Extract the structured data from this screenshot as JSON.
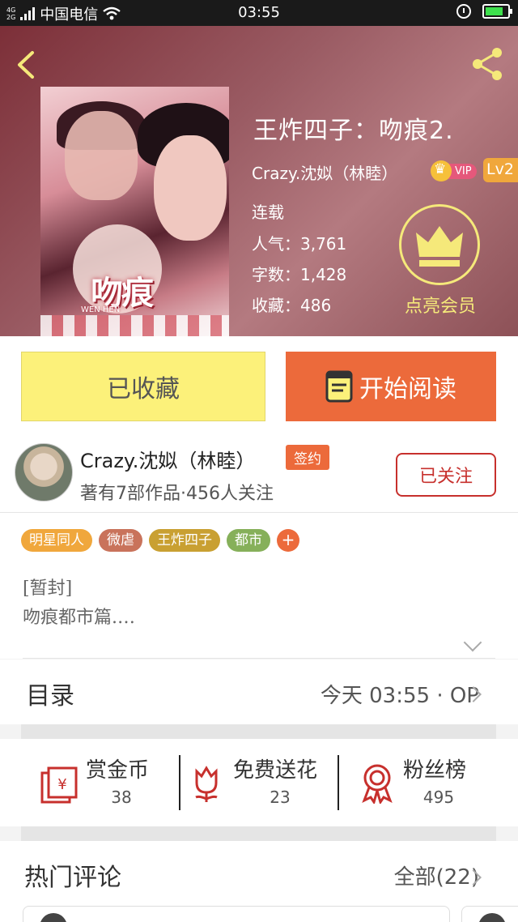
{
  "status_bar": {
    "carrier": "中国电信",
    "net_top": "4G",
    "net_bottom": "2G",
    "time": "03:55"
  },
  "book": {
    "title": "王炸四子：吻痕2.",
    "author": "Crazy.沈姒（林睦）",
    "vip_label": "VIP",
    "level": "Lv2",
    "status": "连载",
    "popularity_label": "人气：",
    "popularity": "3,761",
    "words_label": "字数：",
    "words": "1,428",
    "favorites_label": "收藏：",
    "favorites": "486",
    "member_label": "点亮会员",
    "cover_title": "吻痕",
    "cover_subtitle": "WEN HEN"
  },
  "actions": {
    "collected_label": "已收藏",
    "read_label": "开始阅读"
  },
  "author": {
    "name": "Crazy.沈姒（林睦）",
    "signed_label": "签约",
    "meta": "著有7部作品·456人关注",
    "follow_label": "已关注"
  },
  "tags": [
    {
      "label": "明星同人",
      "color": "#f0a73c"
    },
    {
      "label": "微虐",
      "color": "#c9735b"
    },
    {
      "label": "王炸四子",
      "color": "#c9a032"
    },
    {
      "label": "都市",
      "color": "#86b05a"
    }
  ],
  "tag_more": "+",
  "description": {
    "line1": "[暂封]",
    "line2": "吻痕都市篇.…"
  },
  "catalog": {
    "label": "目录",
    "latest": "今天 03:55 · OP"
  },
  "rewards": [
    {
      "label": "赏金币",
      "count": "38",
      "icon": "coin-envelope-icon"
    },
    {
      "label": "免费送花",
      "count": "23",
      "icon": "flower-icon"
    },
    {
      "label": "粉丝榜",
      "count": "495",
      "icon": "medal-icon"
    }
  ],
  "comments": {
    "title": "热门评论",
    "all_label": "全部(22)"
  },
  "colors": {
    "accent_orange": "#ec6a3b",
    "collected_yellow": "#fcf17a",
    "follow_red": "#c7302d",
    "member_gold": "#f5e97a"
  }
}
